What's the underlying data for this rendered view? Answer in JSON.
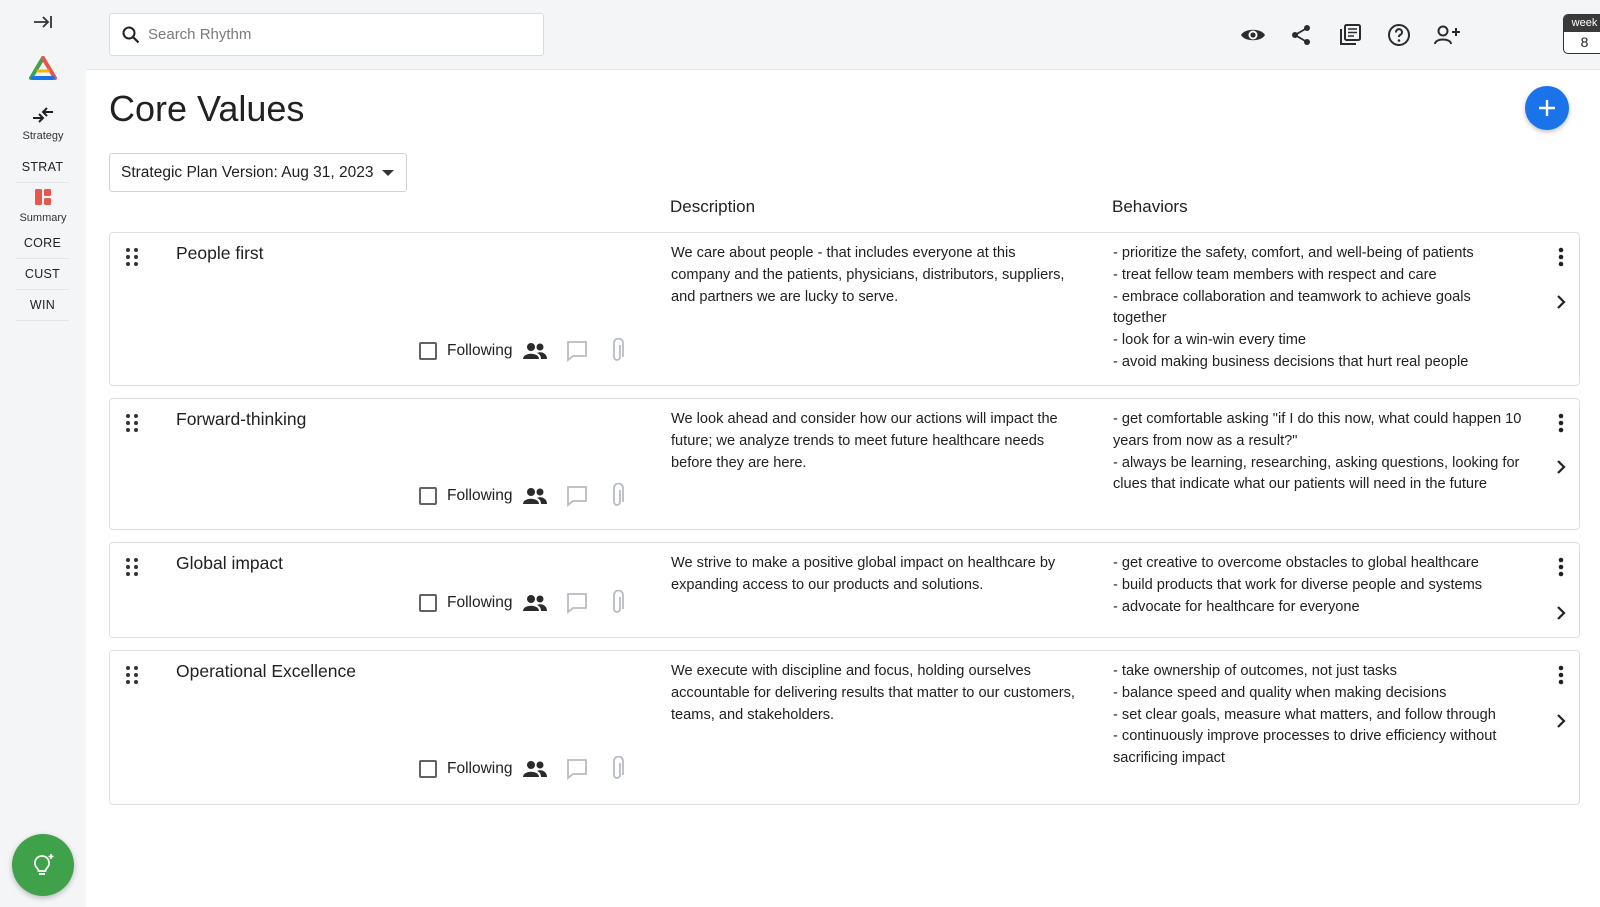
{
  "search": {
    "placeholder": "Search Rhythm"
  },
  "rail": {
    "strategy_label": "Strategy",
    "links": [
      "STRAT",
      "CORE",
      "CUST",
      "WIN"
    ],
    "summary_label": "Summary"
  },
  "topbar": {
    "week_label": "week",
    "week_number": "8"
  },
  "page": {
    "title": "Core Values",
    "version_label": "Strategic Plan Version: Aug 31, 2023",
    "columns": {
      "description": "Description",
      "behaviors": "Behaviors"
    }
  },
  "cards": [
    {
      "title": "People first",
      "description": "We care about people - that includes everyone at this company and the patients, physicians, distributors, suppliers, and partners we are lucky to serve.",
      "behaviors": [
        "- prioritize the safety, comfort, and well-being of patients",
        "- treat fellow team members with respect and care",
        "- embrace collaboration and teamwork to achieve goals together",
        "- look for a win-win every time",
        "- avoid making business decisions that hurt real people"
      ],
      "following_label": "Following"
    },
    {
      "title": "Forward-thinking",
      "description": "We look ahead and consider how our actions will impact the future; we analyze trends to meet future healthcare needs before they are here.",
      "behaviors": [
        "- get comfortable asking \"if I do this now, what could happen 10 years from now as a result?\"",
        "- always be learning, researching, asking questions, looking for clues that indicate what our patients will need in the future"
      ],
      "following_label": "Following"
    },
    {
      "title": "Global impact",
      "description": "We strive to make a positive global impact on healthcare by expanding access to our products and solutions.",
      "behaviors": [
        "- get creative to overcome obstacles to global healthcare",
        "- build products that work for diverse people and systems",
        "- advocate for healthcare for everyone"
      ],
      "following_label": "Following"
    },
    {
      "title": "Operational Excellence",
      "description": "We execute with discipline and focus, holding ourselves accountable for delivering results that matter to our customers, teams, and stakeholders.",
      "behaviors": [
        "- take ownership of outcomes, not just tasks",
        "- balance speed and quality when making decisions",
        "- set clear goals, measure what matters, and follow through",
        "- continuously improve processes to drive efficiency without sacrificing impact"
      ],
      "following_label": "Following"
    }
  ],
  "icons": {
    "expand_rail": "arrow-right-to-bar-icon",
    "logo": "rhythm-triangle-logo",
    "strategy": "swap-arrows-icon",
    "summary": "dashboard-icon",
    "search": "search-icon",
    "view": "eye-icon",
    "share": "share-icon",
    "library": "library-books-icon",
    "help": "help-circle-icon",
    "invite": "add-user-icon",
    "add": "plus-icon",
    "drag": "drag-handle-icon",
    "people": "people-icon",
    "comment": "comment-icon",
    "attachment": "paperclip-icon",
    "more": "more-vertical-icon",
    "chevron": "chevron-right-icon",
    "idea": "lightbulb-icon"
  },
  "colors": {
    "accent_blue": "#1a73e8",
    "idea_green": "#3fa14a",
    "summary_red": "#e8574b"
  }
}
